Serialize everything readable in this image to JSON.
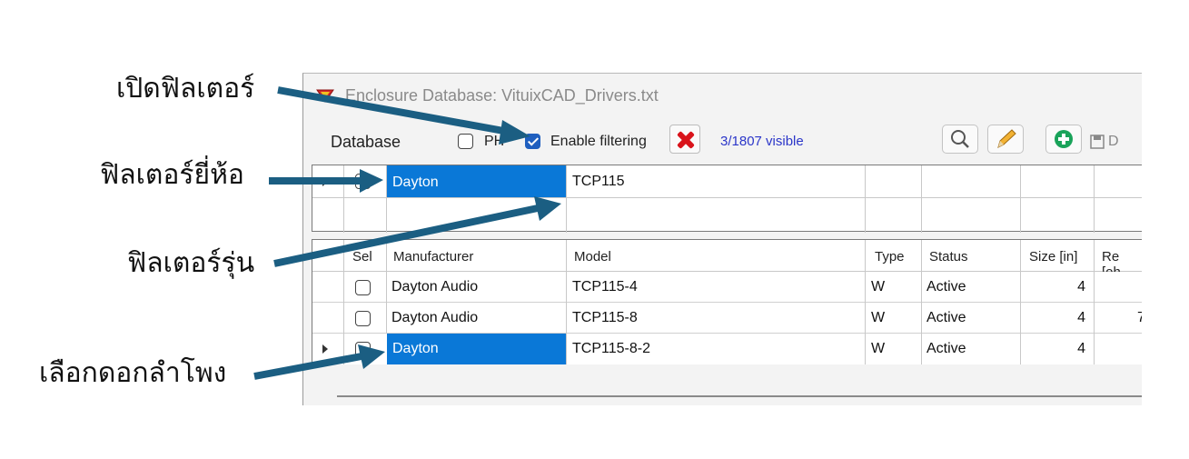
{
  "annotations": {
    "enable_filter": "เปิดฟิลเตอร์",
    "filter_brand": "ฟิลเตอร์ยี่ห้อ",
    "filter_model": "ฟิลเตอร์รุ่น",
    "select_driver": "เลือกดอกลำโพง"
  },
  "window": {
    "title": "Enclosure  Database: VituixCAD_Drivers.txt"
  },
  "toolbar": {
    "database_label": "Database",
    "ph_label": "PH",
    "ph_checked": false,
    "enable_filtering_label": "Enable filtering",
    "enable_filtering_checked": true,
    "visible_count": "3/1807 visible",
    "icons": [
      "clear-filter-icon",
      "search-icon",
      "edit-icon",
      "add-icon",
      "save-icon"
    ],
    "save_label": "D"
  },
  "filter_row": {
    "manufacturer": "Dayton",
    "model": "TCP115"
  },
  "table": {
    "columns": [
      "Sel",
      "Manufacturer",
      "Model",
      "Type",
      "Status",
      "Size [in]",
      "Re [oh"
    ],
    "rows": [
      {
        "manufacturer": "Dayton Audio",
        "model": "TCP115-4",
        "type": "W",
        "status": "Active",
        "size": "4",
        "re": ""
      },
      {
        "manufacturer": "Dayton Audio",
        "model": "TCP115-8",
        "type": "W",
        "status": "Active",
        "size": "4",
        "re": "7"
      },
      {
        "manufacturer": "Dayton",
        "model": "TCP115-8-2",
        "type": "W",
        "status": "Active",
        "size": "4",
        "re": ""
      }
    ]
  },
  "colors": {
    "selection": "#0a78d7",
    "arrow": "#1b5e82",
    "visible_text": "#2b36c9",
    "clear_icon": "#d9141b",
    "add_icon": "#1aa35a"
  }
}
